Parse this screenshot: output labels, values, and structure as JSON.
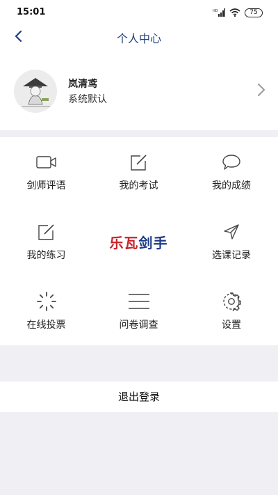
{
  "status_bar": {
    "time": "15:01",
    "battery": "75",
    "icons": [
      "signal-hd-icon",
      "wifi-icon",
      "battery-icon"
    ]
  },
  "nav": {
    "title": "个人中心",
    "back_icon": "chevron-left-icon"
  },
  "profile": {
    "name": "岚清鸢",
    "subtitle": "系统默认",
    "arrow_icon": "chevron-right-icon"
  },
  "menu": [
    {
      "label": "剑师评语",
      "icon": "video-camera-icon"
    },
    {
      "label": "我的考试",
      "icon": "edit-icon"
    },
    {
      "label": "我的成绩",
      "icon": "chat-bubble-icon"
    },
    {
      "label": "我的练习",
      "icon": "edit-icon"
    },
    {
      "label": "选课记录",
      "icon": "send-icon"
    },
    {
      "label": "在线投票",
      "icon": "loading-icon"
    },
    {
      "label": "问卷调查",
      "icon": "menu-lines-icon"
    },
    {
      "label": "设置",
      "icon": "gear-icon"
    }
  ],
  "logo": {
    "part1": "乐瓦",
    "part2": "剑手"
  },
  "logout_label": "退出登录",
  "colors": {
    "nav_title": "#1f3e7a",
    "logo_red": "#c8242c",
    "logo_blue": "#1f3a86",
    "page_bg": "#f0eff4"
  }
}
